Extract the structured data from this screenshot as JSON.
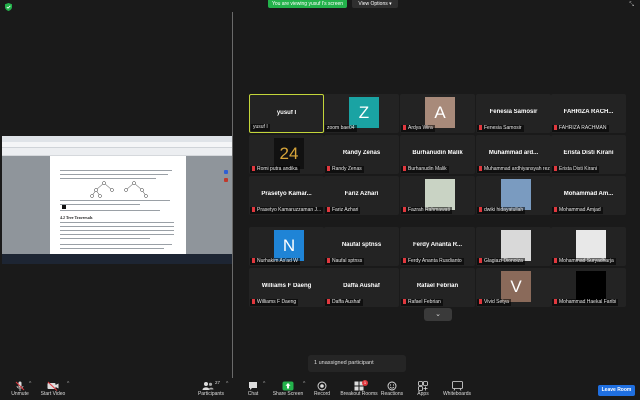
{
  "banner": {
    "viewing": "You are viewing yusuf I's screen",
    "view_options": "View Options"
  },
  "shared_screen": {
    "section_title": "4.2  Tree Traversals"
  },
  "participants": [
    {
      "name": "yusuf I",
      "label": "yusuf I",
      "active": true,
      "muted": false,
      "avatar": null
    },
    {
      "name": "",
      "label": "zoom bae04",
      "muted": false,
      "avatar": {
        "letter": "Z",
        "bg": "#1aa3a3",
        "fg": "#ffffff"
      }
    },
    {
      "name": "",
      "label": "Ardya Wira",
      "muted": true,
      "avatar": {
        "letter": "A",
        "bg": "#a88a7a",
        "fg": "#ffffff"
      }
    },
    {
      "name": "Fenesia Samosir",
      "label": "Fenesia Samosir",
      "muted": true,
      "avatar": null
    },
    {
      "name": "FAHRIZA RACH...",
      "label": "FAHRIZA RACHMAN",
      "muted": true,
      "avatar": null
    },
    {
      "name": "",
      "label": "Romi putra andika",
      "muted": true,
      "avatar": {
        "letter": "24",
        "bg": "#111111",
        "fg": "#d7a53a"
      }
    },
    {
      "name": "Randy Zenas",
      "label": "Randy Zenas",
      "muted": true,
      "avatar": null
    },
    {
      "name": "Burhanudin Malik",
      "label": "Burhanudin Malik",
      "muted": true,
      "avatar": null
    },
    {
      "name": "Muhammad ard...",
      "label": "Muhammad ardhiyansyah rez",
      "muted": true,
      "avatar": null
    },
    {
      "name": "Erista Disti Kirani",
      "label": "Erista Disti Kirani",
      "muted": true,
      "avatar": null
    },
    {
      "name": "Prasetyo Kamar...",
      "label": "Prasetyo Kamaruzzaman J...",
      "muted": true,
      "avatar": null
    },
    {
      "name": "Fariz Azhari",
      "label": "Fariz Azhari",
      "muted": true,
      "avatar": null
    },
    {
      "name": "",
      "label": "Fazrah Rahmawati",
      "muted": true,
      "avatar": {
        "letter": "",
        "bg": "#c9d3c4",
        "fg": "#ffffff"
      }
    },
    {
      "name": "",
      "label": "dwiki hidayatullah",
      "muted": true,
      "avatar": {
        "letter": "",
        "bg": "#7a9bc0",
        "fg": "#ffffff"
      }
    },
    {
      "name": "Mohammad Am...",
      "label": "Mohammad Amjad",
      "muted": true,
      "avatar": null
    },
    {
      "name": "",
      "label": "Nurhakim As'ad W",
      "muted": true,
      "avatar": {
        "letter": "N",
        "bg": "#1f84d6",
        "fg": "#ffffff"
      }
    },
    {
      "name": "Naufal sptnss",
      "label": "Naufal sptnss",
      "muted": true,
      "avatar": null
    },
    {
      "name": "Ferdy Ananta R...",
      "label": "Ferdy Ananta Rusdianto",
      "muted": true,
      "avatar": null
    },
    {
      "name": "",
      "label": "Glagiazi Dionoiza",
      "muted": true,
      "avatar": {
        "letter": "",
        "bg": "#d9d9d9",
        "fg": "#e8b53a"
      }
    },
    {
      "name": "",
      "label": "Mohammad Suryadharja",
      "muted": true,
      "avatar": {
        "letter": "",
        "bg": "#e8e8e8",
        "fg": "#9a9a9a"
      }
    },
    {
      "name": "Williams F Daeng",
      "label": "Williams F Daeng",
      "muted": true,
      "avatar": null
    },
    {
      "name": "Daffa Aushaf",
      "label": "Daffa Aushaf",
      "muted": true,
      "avatar": null
    },
    {
      "name": "Rafael Febrian",
      "label": "Rafael Febrian",
      "muted": true,
      "avatar": null
    },
    {
      "name": "",
      "label": "Vivid Setya",
      "muted": true,
      "avatar": {
        "letter": "V",
        "bg": "#8a6a5a",
        "fg": "#ffffff"
      }
    },
    {
      "name": "",
      "label": "Mohammad Haekal Faribi",
      "muted": true,
      "avatar": {
        "letter": "",
        "bg": "#000000",
        "fg": "#ffffff"
      }
    }
  ],
  "unassigned": "1 unassigned participant",
  "toolbar": {
    "unmute": "Unmute",
    "start_video": "Start Video",
    "participants": "Participants",
    "participant_count": "27",
    "chat": "Chat",
    "share_screen": "Share Screen",
    "record": "Record",
    "breakout_rooms": "Breakout Rooms",
    "breakout_badge": "1",
    "reactions": "Reactions",
    "apps": "Apps",
    "whiteboards": "Whiteboards",
    "leave": "Leave Room"
  },
  "colors": {
    "active_border": "#c3d53a",
    "share_green": "#23b24b",
    "leave_blue": "#1f6fe0",
    "muted_red": "#e0383e"
  }
}
